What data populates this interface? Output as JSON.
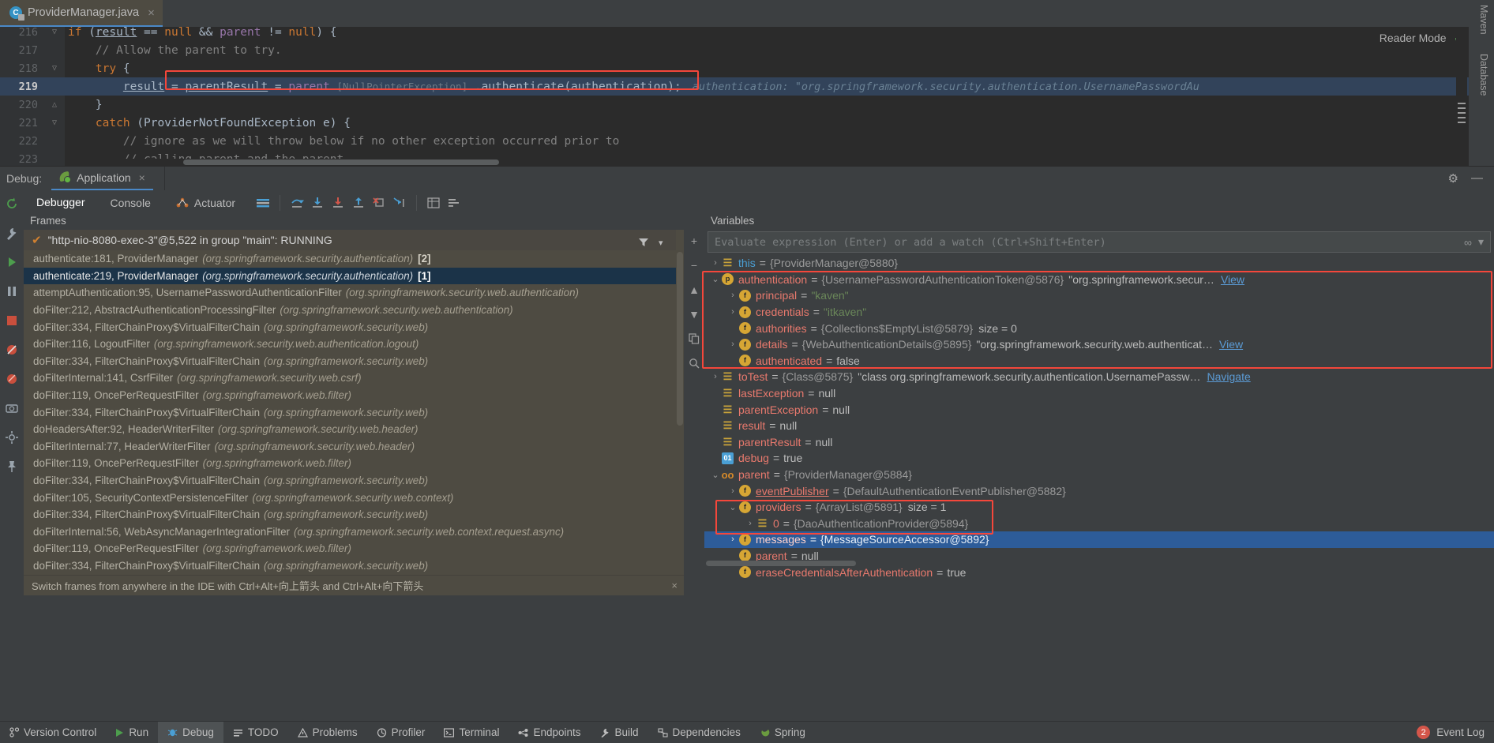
{
  "editor": {
    "tab": {
      "filename": "ProviderManager.java",
      "icon": "java-class-locked-icon",
      "close": "×"
    },
    "more_icon": "⋮",
    "reader_mode": {
      "label": "Reader Mode",
      "check": "✓"
    },
    "lines": [
      {
        "no": "216",
        "fold": "▽",
        "text": "if (result == null && parent != null) {"
      },
      {
        "no": "217",
        "fold": "",
        "text": "// Allow the parent to try."
      },
      {
        "no": "218",
        "fold": "▽",
        "text": "try {"
      },
      {
        "no": "219",
        "fold": "",
        "text": "result = parentResult = parent [NullPointerException] .authenticate(authentication);"
      },
      {
        "no": "220",
        "fold": "△",
        "text": "}"
      },
      {
        "no": "221",
        "fold": "▽",
        "text": "catch (ProviderNotFoundException e) {"
      },
      {
        "no": "222",
        "fold": "",
        "text": "// ignore as we will throw below if no other exception occurred prior to"
      },
      {
        "no": "223",
        "fold": "",
        "text": "// calling parent and the parent"
      }
    ],
    "inline_hint": "authentication: \"org.springframework.security.authentication.UsernamePasswordAu",
    "right_rail": {
      "maven": "Maven",
      "database": "Database"
    }
  },
  "debug_window": {
    "label": "Debug:",
    "session_tab": {
      "name": "Application",
      "icon": "spring-leaf-icon",
      "close": "×"
    },
    "settings_icon": "⚙",
    "minimize_icon": "—",
    "tabs": [
      {
        "label": "Debugger",
        "active": true,
        "icon": ""
      },
      {
        "label": "Console",
        "active": false,
        "icon": ""
      },
      {
        "label": "Actuator",
        "active": false,
        "icon": "actuator-icon"
      }
    ],
    "toolbar_icons": [
      "layout-icon",
      "step-over-icon",
      "step-into-icon",
      "force-step-into-icon",
      "step-out-icon",
      "drop-frame-icon",
      "run-to-cursor-icon",
      "evaluate-table-icon",
      "settings-list-icon"
    ],
    "left_rail_icons": [
      "rerun-icon",
      "wrench-icon",
      "resume-icon",
      "pause-icon",
      "stop-icon",
      "mute-breakpoints-icon",
      "breakpoints-icon",
      "camera-icon",
      "settings-gear-icon",
      "pin-icon"
    ]
  },
  "frames": {
    "title": "Frames",
    "filter_icon": "filter-icon",
    "dropdown_icon": "▾",
    "thread": {
      "check": "✔",
      "text": "\"http-nio-8080-exec-3\"@5,522 in group \"main\": RUNNING"
    },
    "items": [
      {
        "method": "authenticate:181, ProviderManager",
        "pkg": "(org.springframework.security.authentication)",
        "idx": "[2]",
        "selected": false
      },
      {
        "method": "authenticate:219, ProviderManager",
        "pkg": "(org.springframework.security.authentication)",
        "idx": "[1]",
        "selected": true
      },
      {
        "method": "attemptAuthentication:95, UsernamePasswordAuthenticationFilter",
        "pkg": "(org.springframework.security.web.authentication)",
        "idx": "",
        "selected": false
      },
      {
        "method": "doFilter:212, AbstractAuthenticationProcessingFilter",
        "pkg": "(org.springframework.security.web.authentication)",
        "idx": "",
        "selected": false
      },
      {
        "method": "doFilter:334, FilterChainProxy$VirtualFilterChain",
        "pkg": "(org.springframework.security.web)",
        "idx": "",
        "selected": false
      },
      {
        "method": "doFilter:116, LogoutFilter",
        "pkg": "(org.springframework.security.web.authentication.logout)",
        "idx": "",
        "selected": false
      },
      {
        "method": "doFilter:334, FilterChainProxy$VirtualFilterChain",
        "pkg": "(org.springframework.security.web)",
        "idx": "",
        "selected": false
      },
      {
        "method": "doFilterInternal:141, CsrfFilter",
        "pkg": "(org.springframework.security.web.csrf)",
        "idx": "",
        "selected": false
      },
      {
        "method": "doFilter:119, OncePerRequestFilter",
        "pkg": "(org.springframework.web.filter)",
        "idx": "",
        "selected": false
      },
      {
        "method": "doFilter:334, FilterChainProxy$VirtualFilterChain",
        "pkg": "(org.springframework.security.web)",
        "idx": "",
        "selected": false
      },
      {
        "method": "doHeadersAfter:92, HeaderWriterFilter",
        "pkg": "(org.springframework.security.web.header)",
        "idx": "",
        "selected": false
      },
      {
        "method": "doFilterInternal:77, HeaderWriterFilter",
        "pkg": "(org.springframework.security.web.header)",
        "idx": "",
        "selected": false
      },
      {
        "method": "doFilter:119, OncePerRequestFilter",
        "pkg": "(org.springframework.web.filter)",
        "idx": "",
        "selected": false
      },
      {
        "method": "doFilter:334, FilterChainProxy$VirtualFilterChain",
        "pkg": "(org.springframework.security.web)",
        "idx": "",
        "selected": false
      },
      {
        "method": "doFilter:105, SecurityContextPersistenceFilter",
        "pkg": "(org.springframework.security.web.context)",
        "idx": "",
        "selected": false
      },
      {
        "method": "doFilter:334, FilterChainProxy$VirtualFilterChain",
        "pkg": "(org.springframework.security.web)",
        "idx": "",
        "selected": false
      },
      {
        "method": "doFilterInternal:56, WebAsyncManagerIntegrationFilter",
        "pkg": "(org.springframework.security.web.context.request.async)",
        "idx": "",
        "selected": false
      },
      {
        "method": "doFilter:119, OncePerRequestFilter",
        "pkg": "(org.springframework.web.filter)",
        "idx": "",
        "selected": false
      },
      {
        "method": "doFilter:334, FilterChainProxy$VirtualFilterChain",
        "pkg": "(org.springframework.security.web)",
        "idx": "",
        "selected": false
      }
    ]
  },
  "hint_bar": {
    "text": "Switch frames from anywhere in the IDE with Ctrl+Alt+向上箭头 and Ctrl+Alt+向下箭头",
    "close": "×"
  },
  "variables": {
    "title": "Variables",
    "add_icon": "+",
    "remove_icon": "−",
    "up_icon": "▲",
    "down_icon": "▼",
    "copy_icon": "copy-icon",
    "inspect_icon": "inspect-icon",
    "eval_placeholder": "Evaluate expression (Enter) or add a watch (Ctrl+Shift+Enter)",
    "eval_value": "",
    "eval_icons": {
      "infinity": "∞",
      "chevron": "▾"
    },
    "rows": [
      {
        "indent": 0,
        "arrow": "›",
        "icon": "obj",
        "icon_char": "☰",
        "name": "this",
        "name_color": "blue",
        "value": "{ProviderManager@5880}",
        "str": "",
        "size": "",
        "link": "",
        "selected": false
      },
      {
        "indent": 0,
        "arrow": "⌄",
        "icon": "p",
        "icon_char": "p",
        "name": "authentication",
        "name_color": "red",
        "value": "{UsernamePasswordAuthenticationToken@5876}",
        "str": "\"org.springframework.secur…",
        "size": "",
        "link": "View",
        "selected": false
      },
      {
        "indent": 1,
        "arrow": "›",
        "icon": "f",
        "icon_char": "f",
        "name": "principal",
        "name_color": "red",
        "value": "",
        "str": "\"kaven\"",
        "size": "",
        "link": "",
        "selected": false
      },
      {
        "indent": 1,
        "arrow": "›",
        "icon": "f",
        "icon_char": "f",
        "name": "credentials",
        "name_color": "red",
        "value": "",
        "str": "\"itkaven\"",
        "size": "",
        "link": "",
        "selected": false
      },
      {
        "indent": 1,
        "arrow": "",
        "icon": "f",
        "icon_char": "f",
        "name": "authorities",
        "name_color": "red",
        "value": "{Collections$EmptyList@5879}",
        "str": "",
        "size": "size = 0",
        "link": "",
        "selected": false
      },
      {
        "indent": 1,
        "arrow": "›",
        "icon": "f",
        "icon_char": "f",
        "name": "details",
        "name_color": "red",
        "value": "{WebAuthenticationDetails@5895}",
        "str": "\"org.springframework.security.web.authenticat…",
        "size": "",
        "link": "View",
        "selected": false
      },
      {
        "indent": 1,
        "arrow": "",
        "icon": "f",
        "icon_char": "f",
        "name": "authenticated",
        "name_color": "red",
        "value": "false",
        "str": "",
        "size": "",
        "link": "",
        "selected": false
      },
      {
        "indent": 0,
        "arrow": "›",
        "icon": "obj",
        "icon_char": "☰",
        "name": "toTest",
        "name_color": "red",
        "value": "{Class@5875}",
        "str": "\"class org.springframework.security.authentication.UsernamePassw…",
        "size": "",
        "link": "Navigate",
        "selected": false
      },
      {
        "indent": 0,
        "arrow": "",
        "icon": "obj",
        "icon_char": "☰",
        "name": "lastException",
        "name_color": "red",
        "value": "null",
        "str": "",
        "size": "",
        "link": "",
        "selected": false
      },
      {
        "indent": 0,
        "arrow": "",
        "icon": "obj",
        "icon_char": "☰",
        "name": "parentException",
        "name_color": "red",
        "value": "null",
        "str": "",
        "size": "",
        "link": "",
        "selected": false
      },
      {
        "indent": 0,
        "arrow": "",
        "icon": "obj",
        "icon_char": "☰",
        "name": "result",
        "name_color": "red",
        "value": "null",
        "str": "",
        "size": "",
        "link": "",
        "selected": false
      },
      {
        "indent": 0,
        "arrow": "",
        "icon": "obj",
        "icon_char": "☰",
        "name": "parentResult",
        "name_color": "red",
        "value": "null",
        "str": "",
        "size": "",
        "link": "",
        "selected": false
      },
      {
        "indent": 0,
        "arrow": "",
        "icon": "bool",
        "icon_char": "01",
        "name": "debug",
        "name_color": "red",
        "value": "true",
        "str": "",
        "size": "",
        "link": "",
        "selected": false
      },
      {
        "indent": 0,
        "arrow": "⌄",
        "icon": "oo",
        "icon_char": "oo",
        "name": "parent",
        "name_color": "red",
        "value": "{ProviderManager@5884}",
        "str": "",
        "size": "",
        "link": "",
        "selected": false
      },
      {
        "indent": 1,
        "arrow": "›",
        "icon": "f",
        "icon_char": "f",
        "name": "eventPublisher",
        "name_color": "red",
        "value": "{DefaultAuthenticationEventPublisher@5882}",
        "str": "",
        "size": "",
        "link": "",
        "selected": false,
        "underline": true
      },
      {
        "indent": 1,
        "arrow": "⌄",
        "icon": "f",
        "icon_char": "f",
        "name": "providers",
        "name_color": "red",
        "value": "{ArrayList@5891}",
        "str": "",
        "size": "size = 1",
        "link": "",
        "selected": false
      },
      {
        "indent": 2,
        "arrow": "›",
        "icon": "obj",
        "icon_char": "☰",
        "name": "0",
        "name_color": "red",
        "value": "{DaoAuthenticationProvider@5894}",
        "str": "",
        "size": "",
        "link": "",
        "selected": false
      },
      {
        "indent": 1,
        "arrow": "›",
        "icon": "f",
        "icon_char": "f",
        "name": "messages",
        "name_color": "red",
        "value": "{MessageSourceAccessor@5892}",
        "str": "",
        "size": "",
        "link": "",
        "selected": true
      },
      {
        "indent": 1,
        "arrow": "",
        "icon": "f",
        "icon_char": "f",
        "name": "parent",
        "name_color": "red",
        "value": "null",
        "str": "",
        "size": "",
        "link": "",
        "selected": false
      },
      {
        "indent": 1,
        "arrow": "",
        "icon": "f",
        "icon_char": "f",
        "name": "eraseCredentialsAfterAuthentication",
        "name_color": "red",
        "value": "true",
        "str": "",
        "size": "",
        "link": "",
        "selected": false
      }
    ]
  },
  "statusbar": {
    "left_items": [
      {
        "label": "Version Control",
        "icon": "branch-icon"
      },
      {
        "label": "Run",
        "icon": "run-icon"
      },
      {
        "label": "Debug",
        "icon": "debug-icon",
        "active": true
      },
      {
        "label": "TODO",
        "icon": "todo-icon"
      },
      {
        "label": "Problems",
        "icon": "problems-icon"
      },
      {
        "label": "Profiler",
        "icon": "profiler-icon"
      },
      {
        "label": "Terminal",
        "icon": "terminal-icon"
      },
      {
        "label": "Endpoints",
        "icon": "endpoints-icon"
      },
      {
        "label": "Build",
        "icon": "build-icon"
      },
      {
        "label": "Dependencies",
        "icon": "dependencies-icon"
      },
      {
        "label": "Spring",
        "icon": "spring-icon"
      }
    ],
    "right": {
      "badge": "2",
      "label": "Event Log"
    }
  },
  "colors": {
    "accent_blue": "#4a88c7",
    "highlight_red": "#f4473b",
    "selection_blue": "#2d5c99",
    "frame_selection": "#1b3348",
    "editor_bg": "#2b2b2b",
    "panel_bg": "#3c3f41",
    "frames_bg": "#4e4b42"
  }
}
